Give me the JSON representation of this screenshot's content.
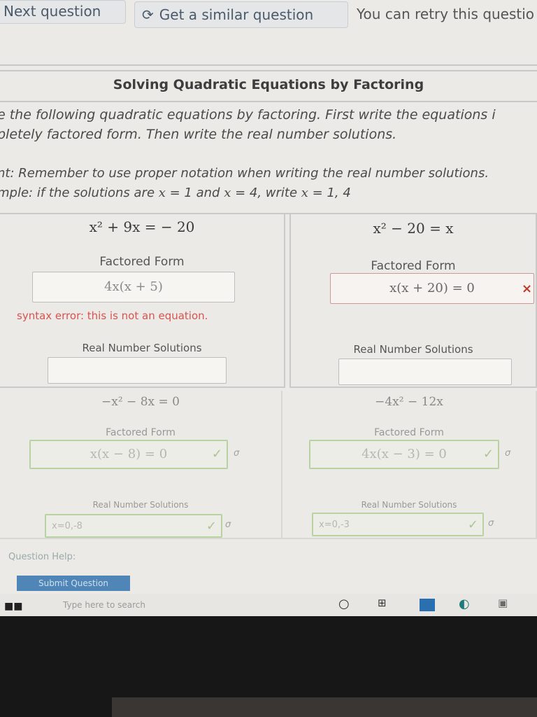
{
  "topbar": {
    "next_label": "Next question",
    "similar_label": "Get a similar question",
    "similar_icon": "refresh-icon",
    "retry_text": "You can retry this questio"
  },
  "title": "Solving Quadratic Equations by Factoring",
  "instructions": {
    "line1": "e the following quadratic equations by factoring. First write the equations i",
    "line2": "pletely factored form. Then write the real number solutions."
  },
  "hint": {
    "line1": "nt: Remember to use proper notation when writing the real number solutions.",
    "line2_a": "mple: if the solutions are ",
    "line2_b": "x",
    "line2_c": " = 1 and ",
    "line2_d": "x",
    "line2_e": " = 4, write ",
    "line2_f": "x",
    "line2_g": " = 1, 4"
  },
  "problems": [
    {
      "equation": "x² + 9x = − 20",
      "factored_label": "Factored Form",
      "factored_value": "4x(x + 5)",
      "error": "syntax error: this is not an equation.",
      "solutions_label": "Real Number Solutions",
      "solutions_value": ""
    },
    {
      "equation": "x² − 20 = x",
      "factored_label": "Factored Form",
      "factored_value": "x(x + 20) = 0",
      "status_icon": "x-icon",
      "solutions_label": "Real Number Solutions",
      "solutions_value": ""
    },
    {
      "equation": "−x² − 8x = 0",
      "factored_label": "Factored Form",
      "factored_value": "x(x − 8) = 0",
      "status_icon": "check-icon",
      "solutions_label": "Real Number Solutions",
      "solutions_value": "x=0,-8"
    },
    {
      "equation": "−4x² − 12x",
      "factored_label": "Factored Form",
      "factored_value": "4x(x − 3) = 0",
      "status_icon": "check-icon",
      "solutions_label": "Real Number Solutions",
      "solutions_value": "x=0,-3"
    }
  ],
  "footer": {
    "help_label": "Question Help:",
    "submit_label": "Submit Question",
    "search_placeholder": "Type here to search"
  },
  "colors": {
    "correct": "#8fbf6a",
    "error": "#d9534f",
    "submit": "#4f86b7"
  }
}
